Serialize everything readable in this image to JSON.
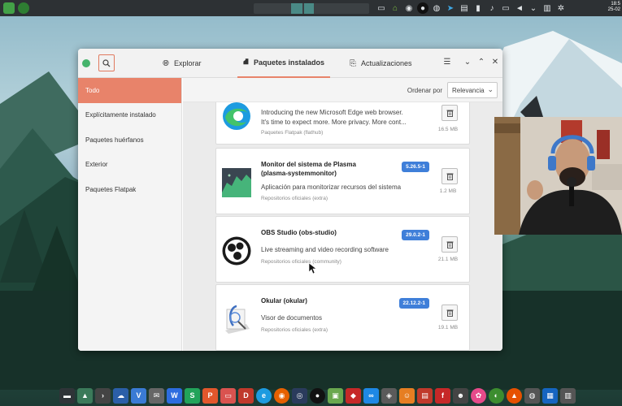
{
  "desktop": {
    "clock": {
      "time": "18:5",
      "date": "25-02"
    }
  },
  "window": {
    "tabs": [
      {
        "label": "Explorar",
        "icon": "globe-icon"
      },
      {
        "label": "Paquetes instalados",
        "icon": "packages-icon"
      },
      {
        "label": "Actualizaciones",
        "icon": "updates-icon"
      }
    ],
    "sidebar": {
      "items": [
        {
          "label": "Todo"
        },
        {
          "label": "Explícitamente instalado"
        },
        {
          "label": "Paquetes huérfanos"
        },
        {
          "label": "Exterior"
        },
        {
          "label": "Paquetes Flatpak"
        }
      ]
    },
    "sort": {
      "label": "Ordenar por",
      "value": "Relevancia"
    },
    "packages": [
      {
        "name": "",
        "description_1": "Introducing the new Microsoft Edge web browser.",
        "description_2": "It's time to expect more. More privacy. More cont...",
        "source": "Paquetes Flatpak (flathub)",
        "version": "",
        "size": "16.5 MB",
        "icon": "edge-icon"
      },
      {
        "name_1": "Monitor del sistema de Plasma",
        "name_2": "(plasma-systemmonitor)",
        "description": "Aplicación para monitorizar recursos del sistema",
        "source": "Repositorios oficiales (extra)",
        "version": "5.26.5-1",
        "size": "1.2 MB",
        "icon": "system-monitor-icon"
      },
      {
        "name": "OBS Studio (obs-studio)",
        "description": "Live streaming and video recording software",
        "source": "Repositorios oficiales (community)",
        "version": "29.0.2-1",
        "size": "21.1 MB",
        "icon": "obs-icon"
      },
      {
        "name": "Okular (okular)",
        "description": "Visor de documentos",
        "source": "Repositorios oficiales (extra)",
        "version": "22.12.2-1",
        "size": "19.1 MB",
        "icon": "okular-icon"
      }
    ]
  },
  "colors": {
    "accent": "#e8836a",
    "version_badge": "#3f7fd9",
    "panel": "#2d3134"
  }
}
